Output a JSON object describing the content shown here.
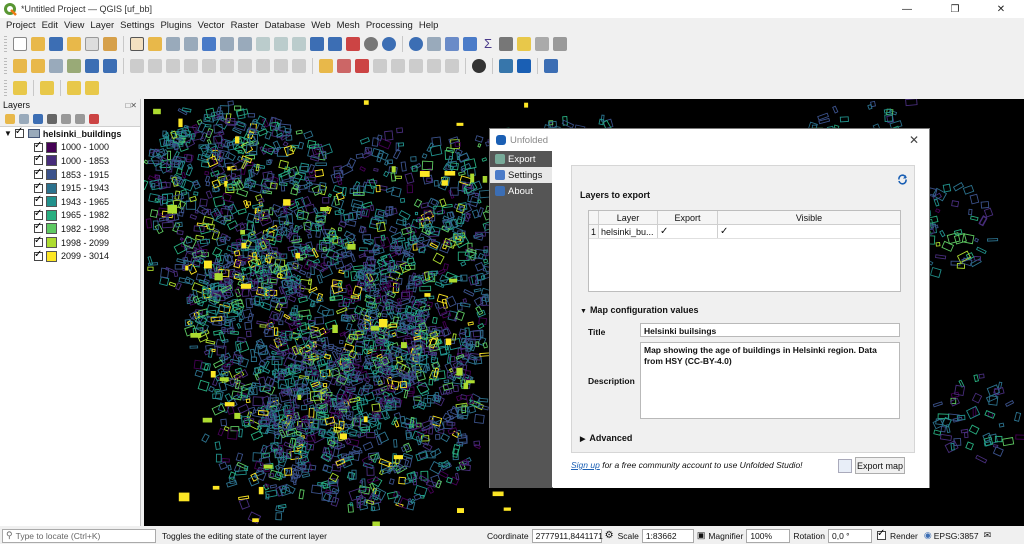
{
  "window": {
    "title": "*Untitled Project — QGIS [uf_bb]"
  },
  "menu": [
    "Project",
    "Edit",
    "View",
    "Layer",
    "Settings",
    "Plugins",
    "Vector",
    "Raster",
    "Database",
    "Web",
    "Mesh",
    "Processing",
    "Help"
  ],
  "layers_panel": {
    "title": "Layers",
    "layer_name": "helsinki_buildings",
    "classes": [
      {
        "label": "1000 - 1000",
        "color": "#440154"
      },
      {
        "label": "1000 - 1853",
        "color": "#472d7b"
      },
      {
        "label": "1853 - 1915",
        "color": "#3b528b"
      },
      {
        "label": "1915 - 1943",
        "color": "#2c728e"
      },
      {
        "label": "1943 - 1965",
        "color": "#21918c"
      },
      {
        "label": "1965 - 1982",
        "color": "#28ae80"
      },
      {
        "label": "1982 - 1998",
        "color": "#5ec962"
      },
      {
        "label": "1998 - 2099",
        "color": "#addc30"
      },
      {
        "label": "2099 - 3014",
        "color": "#fde725"
      }
    ]
  },
  "dialog": {
    "title": "Unfolded",
    "nav": [
      {
        "label": "Export",
        "icon": "export-icon"
      },
      {
        "label": "Settings",
        "icon": "settings-icon"
      },
      {
        "label": "About",
        "icon": "about-icon"
      }
    ],
    "layers_section_title": "Layers to export",
    "table": {
      "headers": [
        "Layer",
        "Export",
        "Visible"
      ],
      "rows": [
        {
          "index": "1",
          "layer": "helsinki_bu...",
          "export": "✓",
          "visible": "✓"
        }
      ]
    },
    "config_section_title": "Map configuration values",
    "title_label": "Title",
    "title_value": "Helsinki builsings",
    "description_label": "Description",
    "description_value": "Map showing the age of buildings in Helsinki region. Data from HSY (CC-BY-4.0)",
    "advanced_label": "Advanced",
    "signup_link": "Sign up",
    "signup_text": " for a free community account to use Unfolded Studio!",
    "export_button": "Export map"
  },
  "statusbar": {
    "locate_placeholder": "Type to locate (Ctrl+K)",
    "message": "Toggles the editing state of the current layer",
    "coordinate_label": "Coordinate",
    "coordinate_value": "2777911,8441171",
    "scale_label": "Scale",
    "scale_value": "1:83662",
    "magnifier_label": "Magnifier",
    "magnifier_value": "100%",
    "rotation_label": "Rotation",
    "rotation_value": "0,0 °",
    "render_label": "Render",
    "crs": "EPSG:3857"
  },
  "colors": {
    "accent": "#1a5fb4",
    "dialog_sidebar": "#555555",
    "map_bg": "#000000"
  }
}
